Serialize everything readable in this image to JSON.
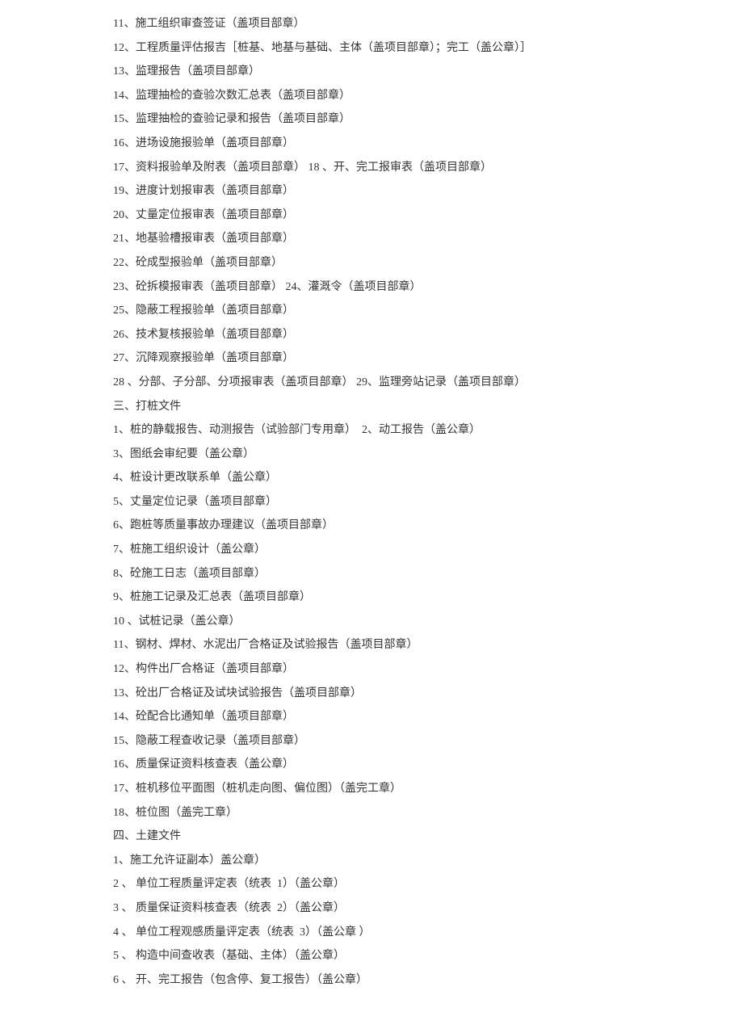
{
  "lines": [
    "11、施工组织审查签证（盖项目部章）",
    "12、工程质量评估报吉［桩基、地基与基础、主体（盖项目部章）；完工（盖公章）］",
    "13、监理报告（盖项目部章）",
    "14、监理抽检的查验次数汇总表（盖项目部章）",
    "15、监理抽检的查验记录和报告（盖项目部章）",
    "16、进场设施报验单（盖项目部章）",
    "17、资料报验单及附表（盖项目部章） 18 、开、完工报审表（盖项目部章）",
    "19、进度计划报审表（盖项目部章）",
    "20、丈量定位报审表（盖项目部章）",
    "21、地基验槽报审表（盖项目部章）",
    "22、砼成型报验单（盖项目部章）",
    "23、砼拆模报审表（盖项目部章） 24、灌溉令（盖项目部章）",
    "25、隐蔽工程报验单（盖项目部章）",
    "26、技术复核报验单（盖项目部章）",
    "27、沉降观察报验单（盖项目部章）",
    "28 、分部、子分部、分项报审表（盖项目部章） 29、监理旁站记录（盖项目部章）",
    "三、打桩文件",
    "1、桩的静载报告、动测报告（试验部门专用章）  2、动工报告（盖公章）",
    "3、图纸会审纪要（盖公章）",
    "4、桩设计更改联系单（盖公章）",
    "5、丈量定位记录（盖项目部章）",
    "6、跑桩等质量事故办理建议（盖项目部章）",
    "7、桩施工组织设计（盖公章）",
    "8、砼施工日志（盖项目部章）",
    "9、桩施工记录及汇总表（盖项目部章）",
    "10 、试桩记录（盖公章）",
    "11、钢材、焊材、水泥出厂合格证及试验报告（盖项目部章）",
    "12、构件出厂合格证（盖项目部章）",
    "13、砼出厂合格证及试块试验报告（盖项目部章）",
    "14、砼配合比通知单（盖项目部章）",
    "15、隐蔽工程查收记录（盖项目部章）",
    "16、质量保证资料核查表（盖公章）",
    "17、桩机移位平面图（桩机走向图、偏位图）（盖完工章）",
    "18、桩位图（盖完工章）",
    "四、土建文件",
    "1、施工允许证副本）盖公章）",
    "2 、 单位工程质量评定表（统表  1）（盖公章）",
    "3 、 质量保证资料核查表（统表  2）（盖公章）",
    "4 、 单位工程观感质量评定表（统表  3）（盖公章 ）",
    "5 、 构造中间查收表（基础、主体）（盖公章）",
    "6 、 开、完工报告（包含停、复工报告）（盖公章）"
  ]
}
